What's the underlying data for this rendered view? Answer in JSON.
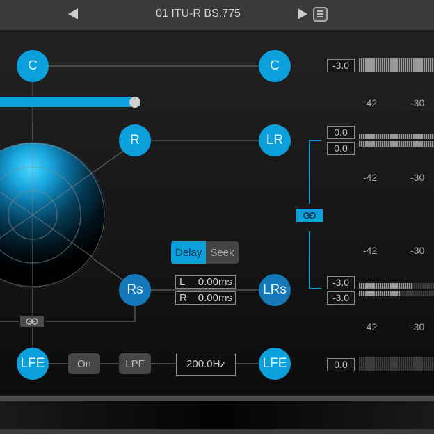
{
  "header": {
    "preset_name": "01 ITU-R BS.775",
    "prev_icon": "triangle-left-icon",
    "next_icon": "triangle-right-icon",
    "menu_icon": "list-menu-icon"
  },
  "routing": {
    "input_nodes": [
      "C",
      "R",
      "Rs",
      "LFE"
    ],
    "output_nodes": [
      "C",
      "LR",
      "LRs",
      "LFE"
    ],
    "width_slider_value_pct": 100
  },
  "delay": {
    "modes": [
      "Delay",
      "Seek"
    ],
    "active_mode": "Delay",
    "left_label": "L",
    "left_value": "0.00ms",
    "right_label": "R",
    "right_value": "0.00ms"
  },
  "lfe": {
    "on_label": "On",
    "filter_label": "LPF",
    "cutoff": "200.0Hz"
  },
  "meters": {
    "scale_labels": [
      "-42",
      "-30"
    ],
    "channels": [
      {
        "name": "C",
        "gains": [
          "-3.0"
        ],
        "levels": [
          1.0
        ]
      },
      {
        "name": "LR",
        "gains": [
          "0.0",
          "0.0"
        ],
        "levels": [
          1.0,
          1.0
        ]
      },
      {
        "name": "LRs",
        "gains": [
          "-3.0",
          "-3.0"
        ],
        "levels": [
          0.7,
          0.55
        ]
      },
      {
        "name": "LFE",
        "gains": [
          "0.0"
        ],
        "levels": [
          0.0
        ]
      }
    ]
  },
  "colors": {
    "accent": "#0ba0dc",
    "accent_dark": "#1578b8",
    "topbar": "#3a3a3a"
  }
}
